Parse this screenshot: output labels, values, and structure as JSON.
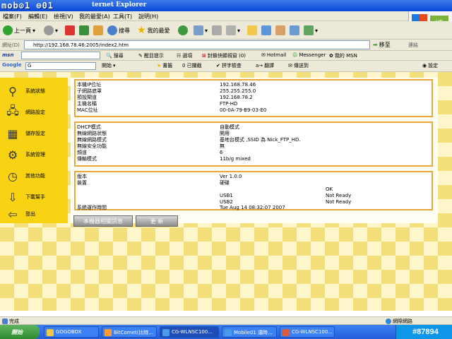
{
  "window": {
    "logo": "mob⊙1 ⊜01",
    "title": "ternet Explorer"
  },
  "menu": [
    "檔案(F)",
    "編輯(E)",
    "檢視(V)",
    "我的最愛(A)",
    "工具(T)",
    "說明(H)"
  ],
  "toolbar": {
    "back": "上一頁",
    "search": "搜尋",
    "favorites": "我的最愛"
  },
  "address": {
    "label": "網址(D)",
    "url": "http://192.168.78.46:2005/index2.htm",
    "go": "移至",
    "links": "連結"
  },
  "msnbar": {
    "logo": "msn",
    "search": "搜尋",
    "highlight": "醒目提示",
    "options": "選項",
    "popup_blocker": "封鎖快顯視窗 (0)",
    "hotmail": "Hotmail",
    "messenger": "Messenger",
    "my_msn": "我的 MSN"
  },
  "googlebar": {
    "logo": "Google",
    "search_value": "G",
    "start": "開始",
    "bookmarks": "書籤",
    "blocked": "0 已攔截",
    "spell": "拼字檢查",
    "translate": "翻譯",
    "send": "傳送到",
    "settings": "設定"
  },
  "nav": [
    {
      "label": "系統狀態",
      "icon": "magnifier-icon"
    },
    {
      "label": "網路設定",
      "icon": "network-icon"
    },
    {
      "label": "儲存設定",
      "icon": "storage-grid-icon"
    },
    {
      "label": "系統管理",
      "icon": "gears-icon"
    },
    {
      "label": "其他功能",
      "icon": "clock-icon"
    },
    {
      "label": "下載幫手",
      "icon": "download-icon"
    },
    {
      "label": "登出",
      "icon": "logout-arrow-icon"
    }
  ],
  "network_info": [
    {
      "label": "本機IP位址",
      "value": "192.168.78.46"
    },
    {
      "label": "子網路遮罩",
      "value": "255.255.255.0"
    },
    {
      "label": "預設閘道",
      "value": "192.168.78.2"
    },
    {
      "label": "主機名稱",
      "value": "FTP-HD"
    },
    {
      "label": "MAC位址",
      "value": "00-0A-79-B9-03-E0"
    }
  ],
  "wireless_info": [
    {
      "label": "DHCP模式",
      "value": "自動模式"
    },
    {
      "label": "無線網路狀態",
      "value": "開用"
    },
    {
      "label": "無線網路模式",
      "value": "基地台模式 ,SSID 為 Nick_FTP_HD."
    },
    {
      "label": "無線安全功能",
      "value": "無"
    },
    {
      "label": "頻道",
      "value": "6"
    },
    {
      "label": "傳輸模式",
      "value": "11b/g mixed"
    }
  ],
  "device_info": {
    "version_label": "版本",
    "version_value": "Ver 1.0.0",
    "device_label": "裝置",
    "device_header": "硬碟",
    "devices": [
      {
        "name": "",
        "status": "OK"
      },
      {
        "name": "USB1",
        "status": "Not Ready"
      },
      {
        "name": "USB2",
        "status": "Not Ready"
      }
    ],
    "uptime_label": "系統運作時間",
    "uptime_value": "Tue Aug 14 08:32:07 2007"
  },
  "buttons": {
    "about": "本機器相關訊息",
    "refresh": "更 新"
  },
  "statusbar": {
    "left": "完成",
    "zone": "網際網路"
  },
  "taskbar": {
    "start": "開始",
    "tasks": [
      "GOGOBOX",
      "BitComet(比特...",
      "CG-WLNSC100...",
      "Mobile01 議時...",
      "CG-WLNSC100..."
    ],
    "watermark": "#87894"
  }
}
